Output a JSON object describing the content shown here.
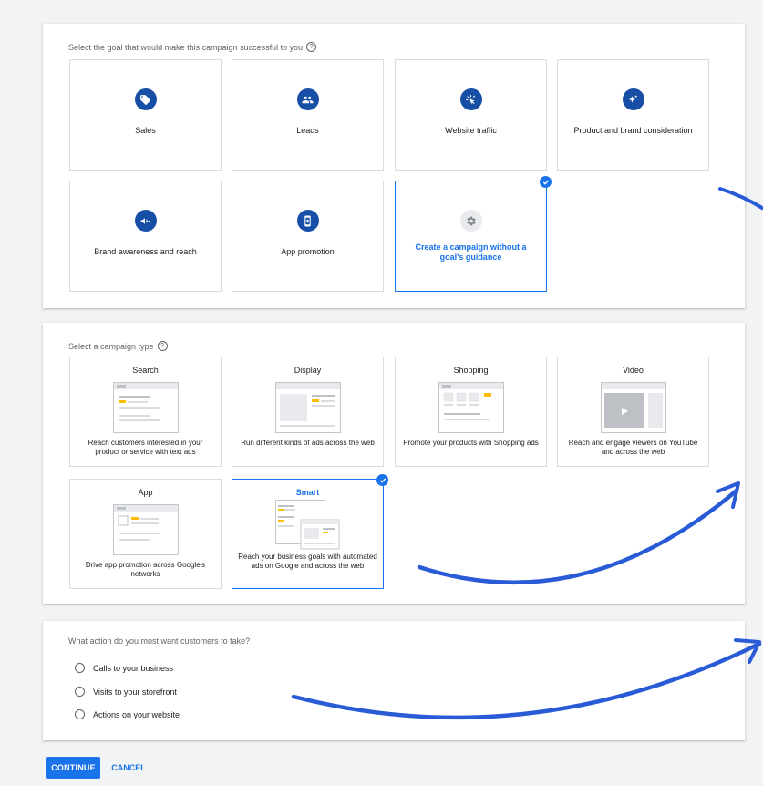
{
  "goal_section": {
    "label": "Select the goal that would make this campaign successful to you",
    "goals": [
      {
        "label": "Sales",
        "icon": "tag-icon"
      },
      {
        "label": "Leads",
        "icon": "people-icon"
      },
      {
        "label": "Website traffic",
        "icon": "cursor-click-icon"
      },
      {
        "label": "Product and brand consideration",
        "icon": "sparkle-icon"
      },
      {
        "label": "Brand awareness and reach",
        "icon": "megaphone-icon"
      },
      {
        "label": "App promotion",
        "icon": "phone-icon"
      },
      {
        "label": "Create a campaign without a goal's guidance",
        "icon": "gear-icon",
        "selected": true
      }
    ]
  },
  "type_section": {
    "label": "Select a campaign type",
    "types": [
      {
        "title": "Search",
        "description": "Reach customers interested in your product or service with text ads"
      },
      {
        "title": "Display",
        "description": "Run different kinds of ads across the web"
      },
      {
        "title": "Shopping",
        "description": "Promote your products with Shopping ads"
      },
      {
        "title": "Video",
        "description": "Reach and engage viewers on YouTube and across the web"
      },
      {
        "title": "App",
        "description": "Drive app promotion across Google's networks"
      },
      {
        "title": "Smart",
        "description": "Reach your business goals with automated ads on Google and across the web",
        "selected": true
      }
    ]
  },
  "action_section": {
    "question": "What action do you most want customers to take?",
    "options": [
      "Calls to your business",
      "Visits to your storefront",
      "Actions on your website"
    ]
  },
  "buttons": {
    "continue": "CONTINUE",
    "cancel": "CANCEL"
  },
  "colors": {
    "accent": "#1a73e8",
    "icon_fill": "#174ea6",
    "annotation": "#2a5bd7",
    "thumb_accent": "#fbbc04"
  }
}
